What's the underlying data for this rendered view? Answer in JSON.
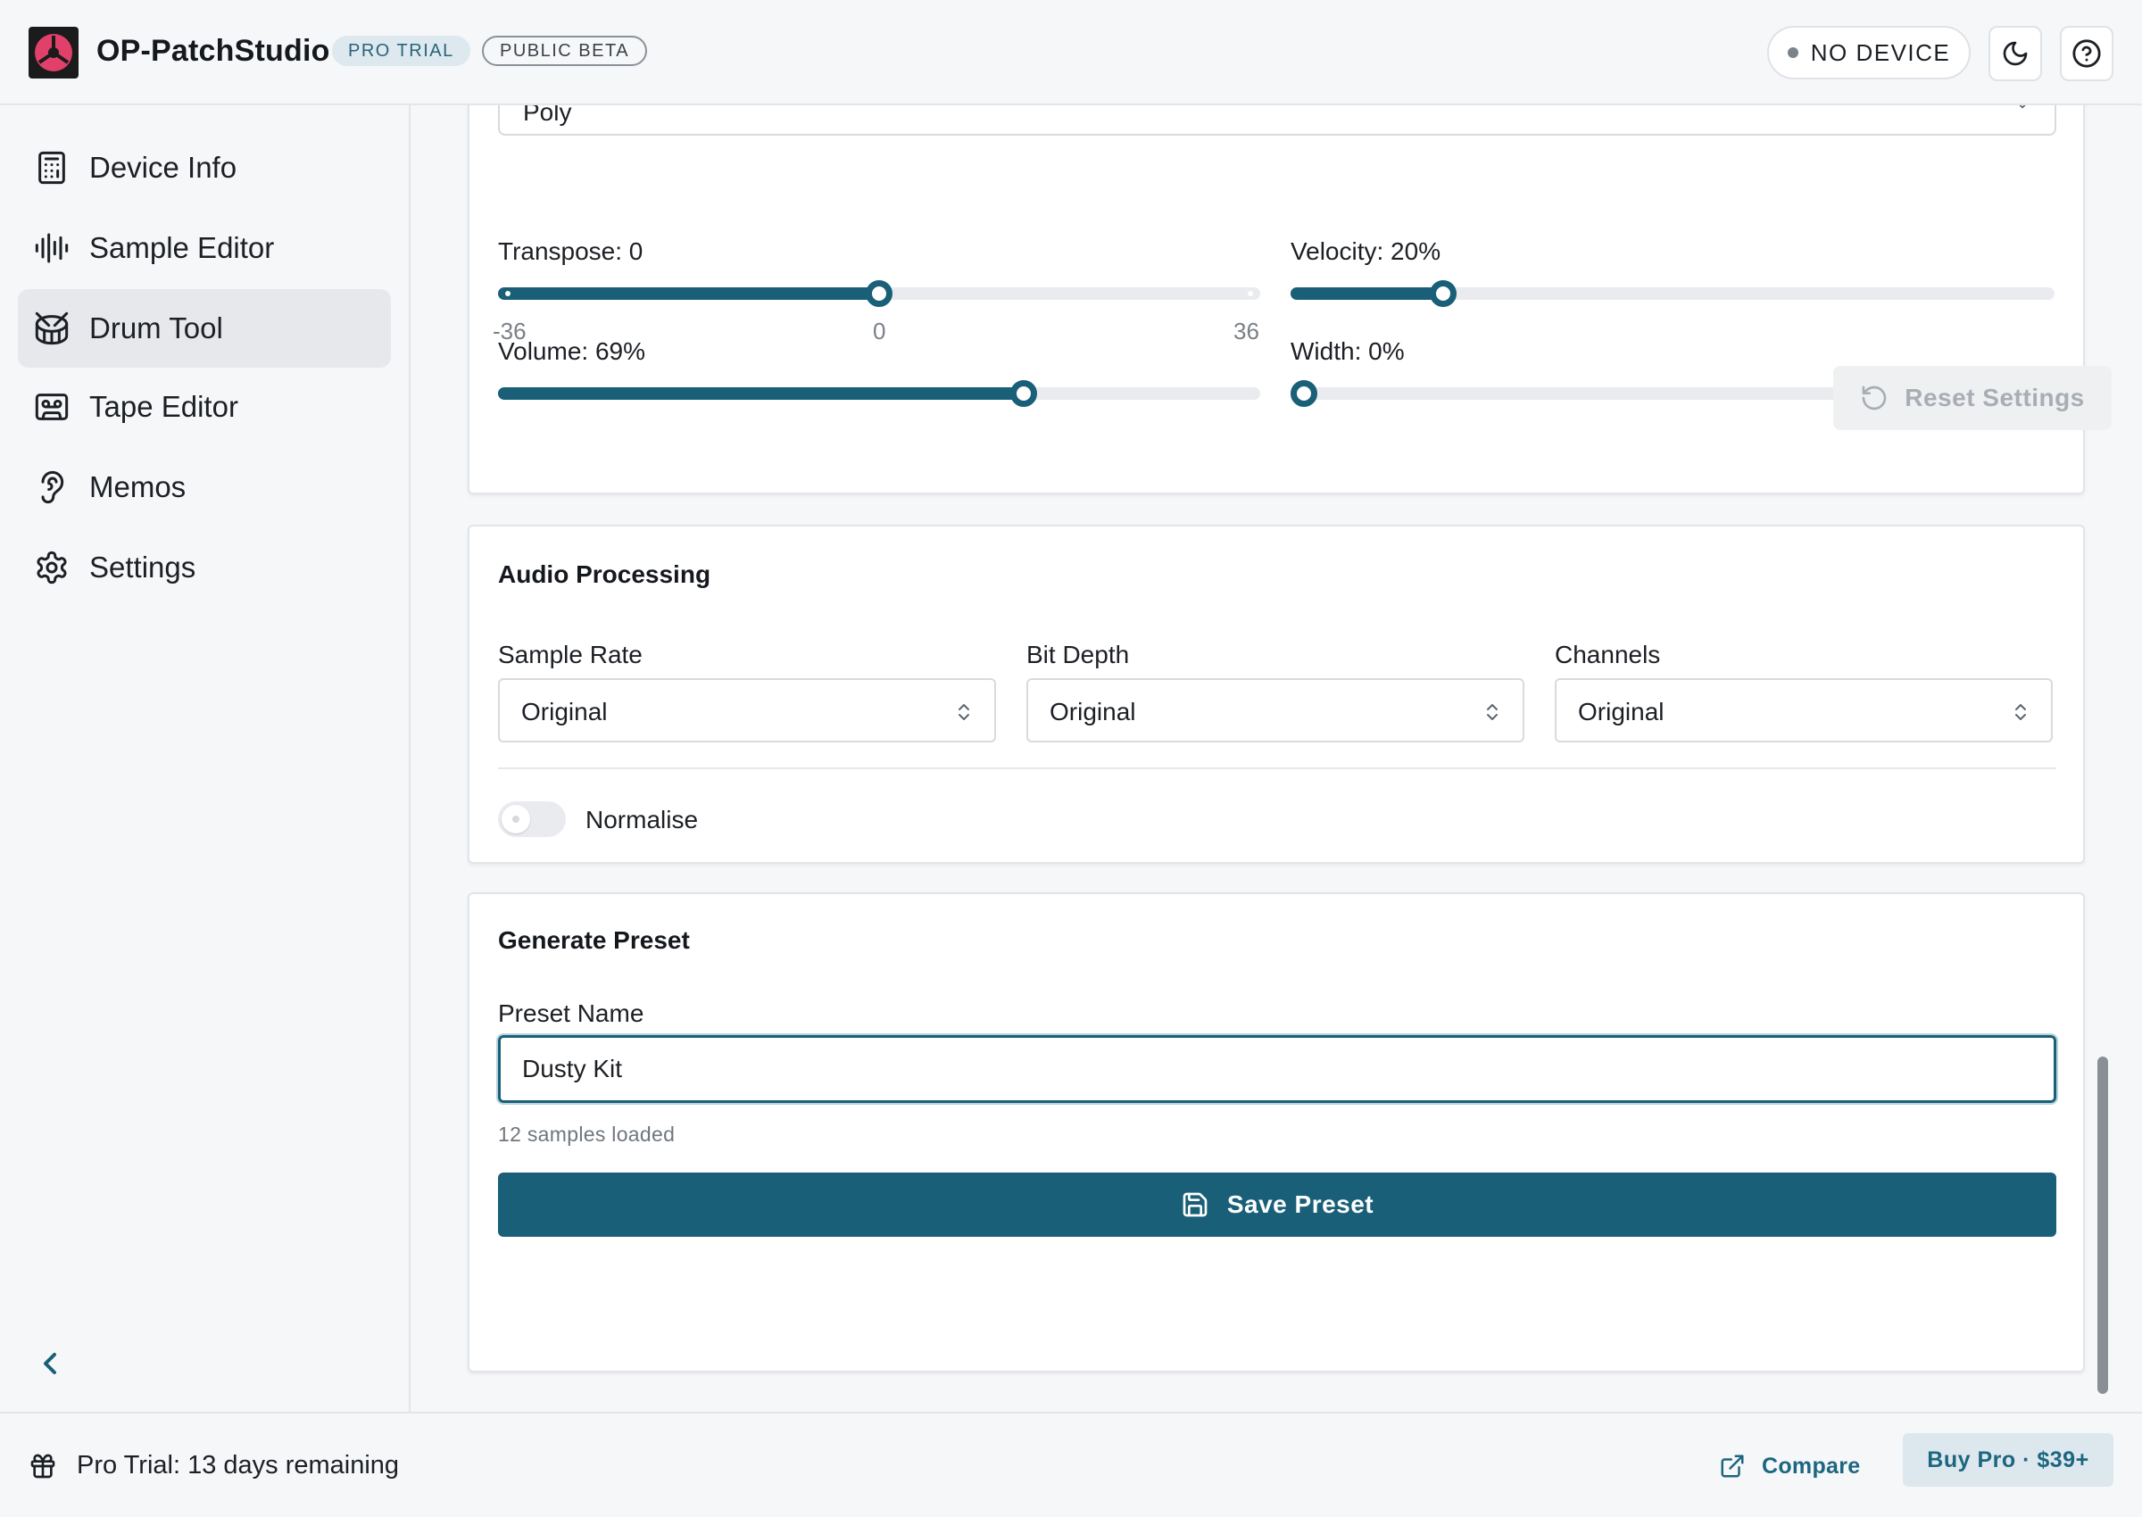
{
  "app": {
    "title": "OP-PatchStudio",
    "badge_trial": "PRO TRIAL",
    "badge_beta": "PUBLIC BETA",
    "device_status": "NO DEVICE"
  },
  "sidebar": {
    "items": [
      {
        "label": "Device Info",
        "icon": "calculator-icon"
      },
      {
        "label": "Sample Editor",
        "icon": "waveform-icon"
      },
      {
        "label": "Drum Tool",
        "icon": "drum-icon",
        "active": true
      },
      {
        "label": "Tape Editor",
        "icon": "cassette-icon"
      },
      {
        "label": "Memos",
        "icon": "ear-icon"
      },
      {
        "label": "Settings",
        "icon": "gear-icon"
      }
    ]
  },
  "playmode": {
    "value": "Poly"
  },
  "sliders": {
    "transpose": {
      "label": "Transpose: 0",
      "min_label": "-36",
      "mid_label": "0",
      "max_label": "36",
      "min": -36,
      "max": 36,
      "value": 0
    },
    "velocity": {
      "label": "Velocity: 20%",
      "value_fraction": 0.2
    },
    "volume": {
      "label": "Volume: 69%",
      "value_fraction": 0.69
    },
    "width": {
      "label": "Width: 0%",
      "value_fraction": 0.0
    }
  },
  "reset": {
    "label": "Reset Settings"
  },
  "audio_processing": {
    "title": "Audio Processing",
    "sample_rate": {
      "label": "Sample Rate",
      "value": "Original"
    },
    "bit_depth": {
      "label": "Bit Depth",
      "value": "Original"
    },
    "channels": {
      "label": "Channels",
      "value": "Original"
    },
    "normalise": {
      "label": "Normalise",
      "enabled": false
    }
  },
  "generate_preset": {
    "title": "Generate Preset",
    "preset_name_label": "Preset Name",
    "preset_name_value": "Dusty Kit",
    "hint": "12 samples loaded",
    "save_label": "Save Preset"
  },
  "footer": {
    "trial_text": "Pro Trial: 13 days remaining",
    "compare_label": "Compare",
    "buy_label": "Buy Pro · $39+"
  },
  "colors": {
    "accent": "#185f77",
    "logo_pink": "#e0406a",
    "background": "#f6f7f9"
  }
}
